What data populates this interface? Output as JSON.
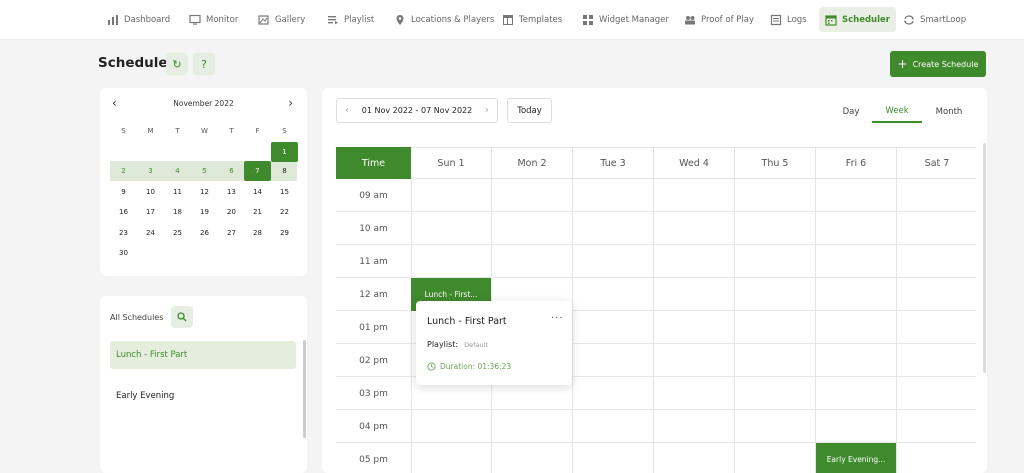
{
  "nav": {
    "items": [
      {
        "label": "Dashboard",
        "icon": "dashboard-icon"
      },
      {
        "label": "Monitor",
        "icon": "monitor-icon"
      },
      {
        "label": "Gallery",
        "icon": "gallery-icon"
      },
      {
        "label": "Playlist",
        "icon": "playlist-icon"
      },
      {
        "label": "Locations & Players",
        "icon": "location-pin-icon"
      },
      {
        "label": "Templates",
        "icon": "templates-icon"
      },
      {
        "label": "Widget Manager",
        "icon": "widget-grid-icon"
      },
      {
        "label": "Proof of Play",
        "icon": "proof-of-play-icon"
      },
      {
        "label": "Logs",
        "icon": "logs-icon"
      },
      {
        "label": "Scheduler",
        "icon": "calendar-icon",
        "active": true
      },
      {
        "label": "SmartLoop",
        "icon": "loop-icon"
      }
    ]
  },
  "header": {
    "title": "Scheduler",
    "refresh_icon": "↻",
    "help_icon": "?",
    "create_label": "Create Schedule"
  },
  "mini_calendar": {
    "month_label": "November 2022",
    "weekdays": [
      "S",
      "M",
      "T",
      "W",
      "T",
      "F",
      "S"
    ],
    "weeks": [
      [
        "",
        "",
        "",
        "",
        "",
        "",
        "1"
      ],
      [
        "2",
        "3",
        "4",
        "5",
        "6",
        "7",
        "8"
      ],
      [
        "9",
        "10",
        "11",
        "12",
        "13",
        "14",
        "15"
      ],
      [
        "16",
        "17",
        "18",
        "19",
        "20",
        "21",
        "22"
      ],
      [
        "23",
        "24",
        "25",
        "26",
        "27",
        "28",
        "29"
      ],
      [
        "30",
        "",
        "",
        "",
        "",
        "",
        ""
      ]
    ]
  },
  "schedules": {
    "title": "All Schedules",
    "items": [
      {
        "label": "Lunch - First Part",
        "active": true
      },
      {
        "label": "Early Evening",
        "active": false
      }
    ]
  },
  "calendar": {
    "range_label": "01 Nov 2022 - 07 Nov 2022",
    "today_label": "Today",
    "views": [
      {
        "label": "Day",
        "active": false
      },
      {
        "label": "Week",
        "active": true
      },
      {
        "label": "Month",
        "active": false
      }
    ],
    "time_header": "Time",
    "days": [
      "Sun 1",
      "Mon 2",
      "Tue 3",
      "Wed 4",
      "Thu 5",
      "Fri 6",
      "Sat 7"
    ],
    "hours": [
      "09 am",
      "10 am",
      "11 am",
      "12 am",
      "01 pm",
      "02 pm",
      "03 pm",
      "04 pm",
      "05 pm"
    ],
    "events": [
      {
        "label": "Lunch - First...",
        "day": 0,
        "hour": 3
      },
      {
        "label": "Early Evening...",
        "day": 5,
        "hour": 8
      }
    ]
  },
  "popup": {
    "title": "Lunch - First Part",
    "more": "···",
    "playlist_label": "Playlist:",
    "playlist_value": "Default",
    "duration_label": "Duration: 01:36:23"
  },
  "colors": {
    "accent": "#3f8a2c",
    "accent_light": "#e5eedd"
  }
}
